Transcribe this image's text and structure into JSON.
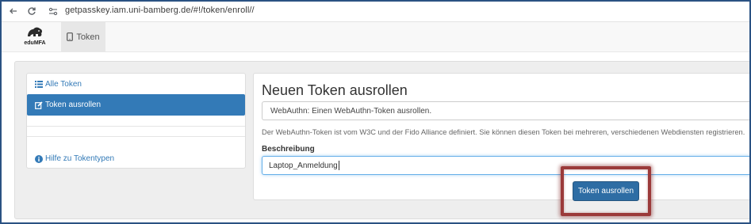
{
  "browser": {
    "url": "getpasskey.iam.uni-bamberg.de/#!/token/enroll//"
  },
  "navbar": {
    "brand_label": "eduMFA",
    "token_tab_label": "Token"
  },
  "sidebar": {
    "items": [
      {
        "label": "Alle Token",
        "icon": "list-icon",
        "active": false
      },
      {
        "label": "Token ausrollen",
        "icon": "edit-icon",
        "active": true
      },
      {
        "label": "Hilfe zu Tokentypen",
        "icon": "info-circle-icon",
        "active": false
      }
    ]
  },
  "main": {
    "title": "Neuen Token ausrollen",
    "token_type_selected": "WebAuthn: Einen WebAuthn-Token ausrollen.",
    "type_description": "Der WebAuthn-Token ist vom W3C und der Fido Alliance definiert. Sie können diesen Token bei mehreren, verschiedenen Webdiensten registrieren.",
    "description_label": "Beschreibung",
    "description_value": "Laptop_Anmeldung",
    "enroll_button_label": "Token ausrollen"
  },
  "colors": {
    "primary": "#337ab7",
    "button": "#2e6da4",
    "highlight": "#9b3a3a",
    "frame": "#2a5283"
  }
}
